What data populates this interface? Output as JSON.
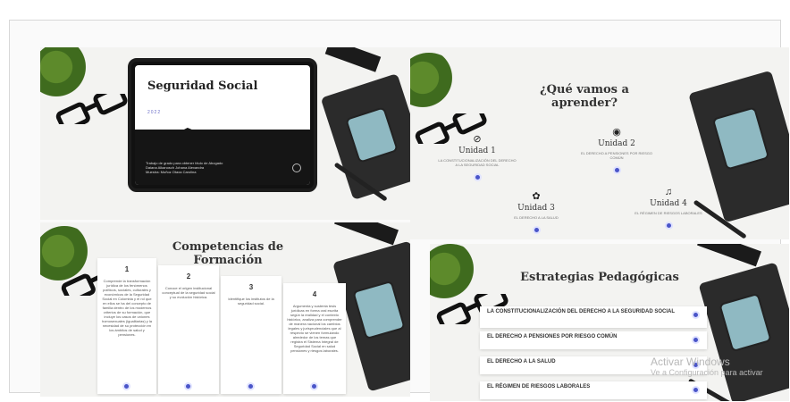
{
  "slide1": {
    "title": "Seguridad Social",
    "year": "2022",
    "info": "Trabajo de grado para obtener título de Abogado\nDaiana Alkanosch Johana Alexandra\nMuestra: Muñoz Otaxa Carolina"
  },
  "slide2": {
    "title": "¿Qué vamos a aprender?",
    "units": [
      {
        "icon": "paperclip-icon",
        "glyph": "⊘",
        "name": "Unidad 1",
        "desc": "LA CONSTITUCIONALIZACIÓN DEL DERECHO A LA SEGURIDAD SOCIAL"
      },
      {
        "icon": "eye-icon",
        "glyph": "◉",
        "name": "Unidad 2",
        "desc": "EL DERECHO A PENSIONES POR RIESGO COMÚN"
      },
      {
        "icon": "gear-icon",
        "glyph": "✿",
        "name": "Unidad 3",
        "desc": "EL DERECHO A LA SALUD"
      },
      {
        "icon": "music-note-icon",
        "glyph": "♫",
        "name": "Unidad 4",
        "desc": "EL RÉGIMEN DE RIESGOS LABORALES"
      }
    ]
  },
  "slide3": {
    "title": "Competencias de Formación",
    "cards": [
      {
        "num": "1",
        "text": "Comprende la transformación jurídica de los fenómenos políticos, sociales, culturales y económicos de la Seguridad Social en Colombia y el rol que en ellos se ha del concepto de familia dentro de los modernos criterios de su formación, que incluye los casos de uniones homosexuales (igualitarias) y la necesidad de su protección en los ámbitos de salud y pensiones."
      },
      {
        "num": "2",
        "text": "Conoce el origen institucional conceptual de la seguridad social y su evolución histórica."
      },
      {
        "num": "3",
        "text": "Identifique los institutos de la seguridad social."
      },
      {
        "num": "4",
        "text": "Argumenta y sustenta tesis jurídicas en forma oral escrita según la realidad y el contexto histórico, analiza para comprender de manera nacional los cambios legales y jurisprudenciales que al respecto se vienen formulando alrededor de los temas que registra el Sistema Integral de Seguridad Social en salud pensiones y riesgos laborales."
      }
    ]
  },
  "slide4": {
    "title": "Estrategias Pedagógicas",
    "items": [
      "LA CONSTITUCIONALIZACIÓN DEL DERECHO A LA SEGURIDAD SOCIAL",
      "EL DERECHO A PENSIONES POR RIESGO COMÚN",
      "EL DERECHO A LA SALUD",
      "EL RÉGIMEN DE RIESGOS LABORALES"
    ]
  },
  "watermark": {
    "title": "Activar Windows",
    "sub": "Ve a Configuración para activar"
  },
  "colors": {
    "accent": "#4a55c9",
    "dark": "#151515",
    "plant": "#4f7d25"
  }
}
